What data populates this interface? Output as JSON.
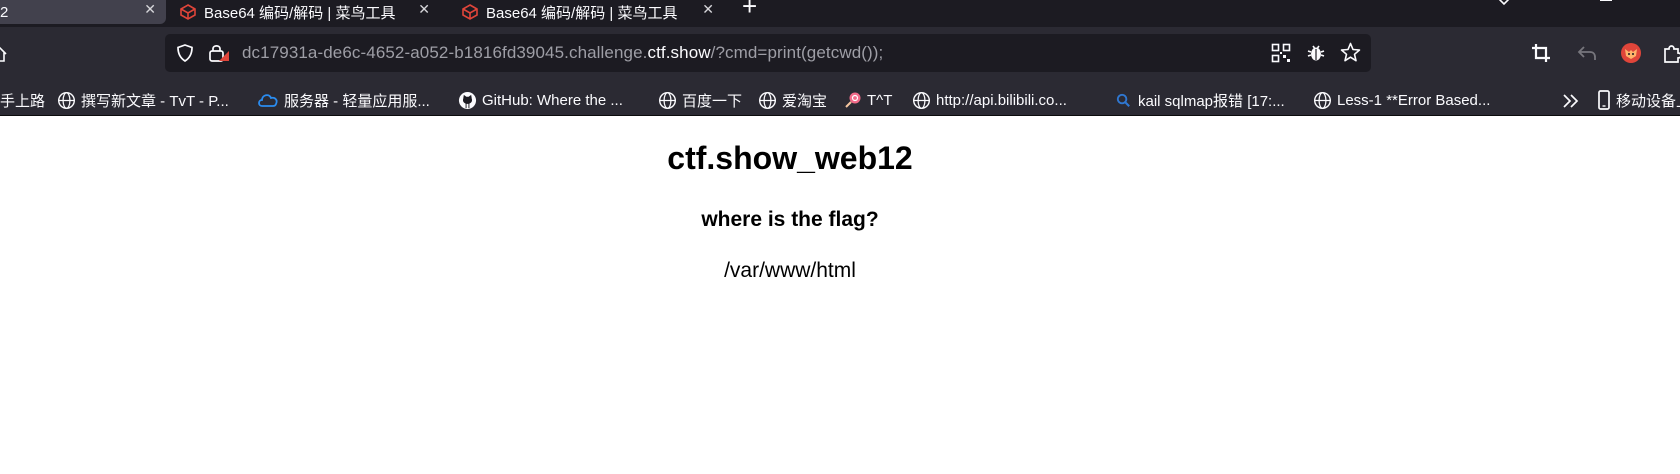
{
  "tabs": [
    {
      "title": "2",
      "active": true
    },
    {
      "title": "Base64 编码/解码 | 菜鸟工具",
      "active": false
    },
    {
      "title": "Base64 编码/解码 | 菜鸟工具",
      "active": false
    }
  ],
  "icons": {
    "tab_close": "close-icon",
    "new_tab": "plus-icon",
    "tab_favicon": "runoob-cube-icon",
    "tabs_menu": "chevron-down-icon",
    "minimize": "minimize-icon",
    "home": "home-icon",
    "shield": "shield-icon",
    "lock": "lock-warning-icon",
    "qr": "qr-code-icon",
    "bug": "bug-icon",
    "star": "star-icon",
    "crop": "crop-icon",
    "undo": "undo-icon",
    "avatar": "fox-avatar-icon",
    "extensions": "puzzle-icon",
    "more_bookmarks": "double-chevron-icon",
    "mobile": "mobile-device-icon"
  },
  "address_bar": {
    "url_prefix": "dc17931a-de6c-4652-a052-b1816fd39045.challenge.",
    "url_domain": "ctf.show",
    "url_suffix": "/?cmd=print(getcwd());"
  },
  "bookmarks": [
    {
      "label": "手上路",
      "icon": "none"
    },
    {
      "label": "撰写新文章 - TvT - P...",
      "icon": "globe-icon"
    },
    {
      "label": "服务器 - 轻量应用服...",
      "icon": "cloud-icon"
    },
    {
      "label": "GitHub: Where the ...",
      "icon": "github-icon"
    },
    {
      "label": "百度一下",
      "icon": "globe-icon"
    },
    {
      "label": "爱淘宝",
      "icon": "globe-icon"
    },
    {
      "label": "T^T",
      "icon": "lollipop-icon"
    },
    {
      "label": "http://api.bilibili.co...",
      "icon": "globe-icon"
    },
    {
      "label": "kail sqlmap报错 [17:...",
      "icon": "search-icon"
    },
    {
      "label": "Less-1 **Error Based...",
      "icon": "globe-icon"
    },
    {
      "label": "移动设备上",
      "icon": "mobile-device-icon"
    }
  ],
  "page": {
    "title": "ctf.show_web12",
    "subtitle": "where is the flag?",
    "output": "/var/www/html"
  },
  "colors": {
    "chrome_bg": "#1c1b22",
    "toolbar_bg": "#2b2a33",
    "active_tab": "#42414d",
    "text_light": "#fbfbfe",
    "url_dim": "#9e9ea6",
    "runoob_red": "#e0453a",
    "cloud_blue": "#2a8cf0",
    "search_blue": "#2f77d1"
  }
}
